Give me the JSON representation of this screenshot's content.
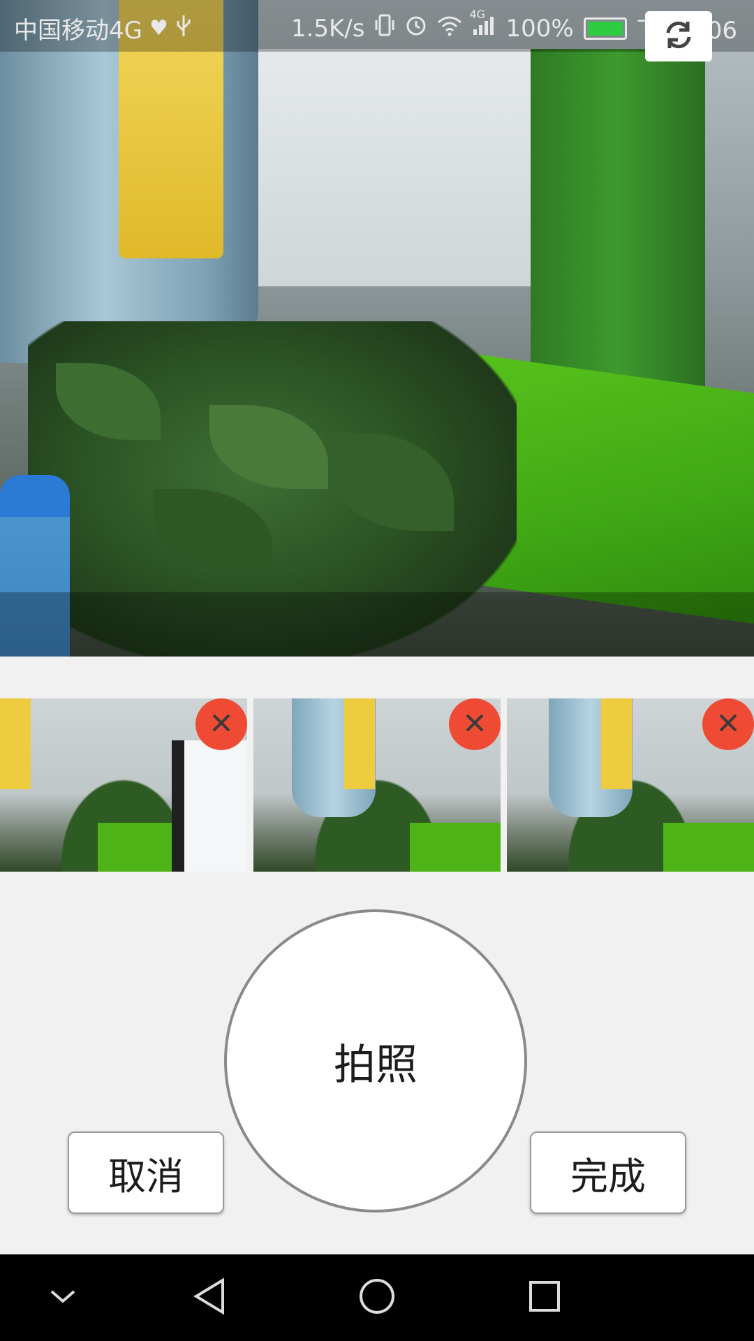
{
  "status_bar": {
    "carrier": "中国移动4G",
    "speed": "1.5K/s",
    "network_badge": "4G",
    "battery": "100%",
    "time": "下午2:06",
    "icons": [
      "heart-icon",
      "usb-icon",
      "vibrate-icon",
      "alarm-icon",
      "wifi-icon",
      "signal-icon",
      "battery-icon"
    ]
  },
  "camera": {
    "switch_icon": "camera-switch-icon"
  },
  "thumbnails": [
    {
      "delete_icon": "close-icon"
    },
    {
      "delete_icon": "close-icon"
    },
    {
      "delete_icon": "close-icon"
    }
  ],
  "actions": {
    "shutter_label": "拍照",
    "cancel_label": "取消",
    "done_label": "完成"
  },
  "nav_bar": {
    "icons": [
      "chevron-down-icon",
      "back-icon",
      "home-icon",
      "recents-icon"
    ]
  },
  "colors": {
    "delete_badge": "#ef4b34",
    "background": "#f1f1f1",
    "nav_bar": "#000000"
  }
}
